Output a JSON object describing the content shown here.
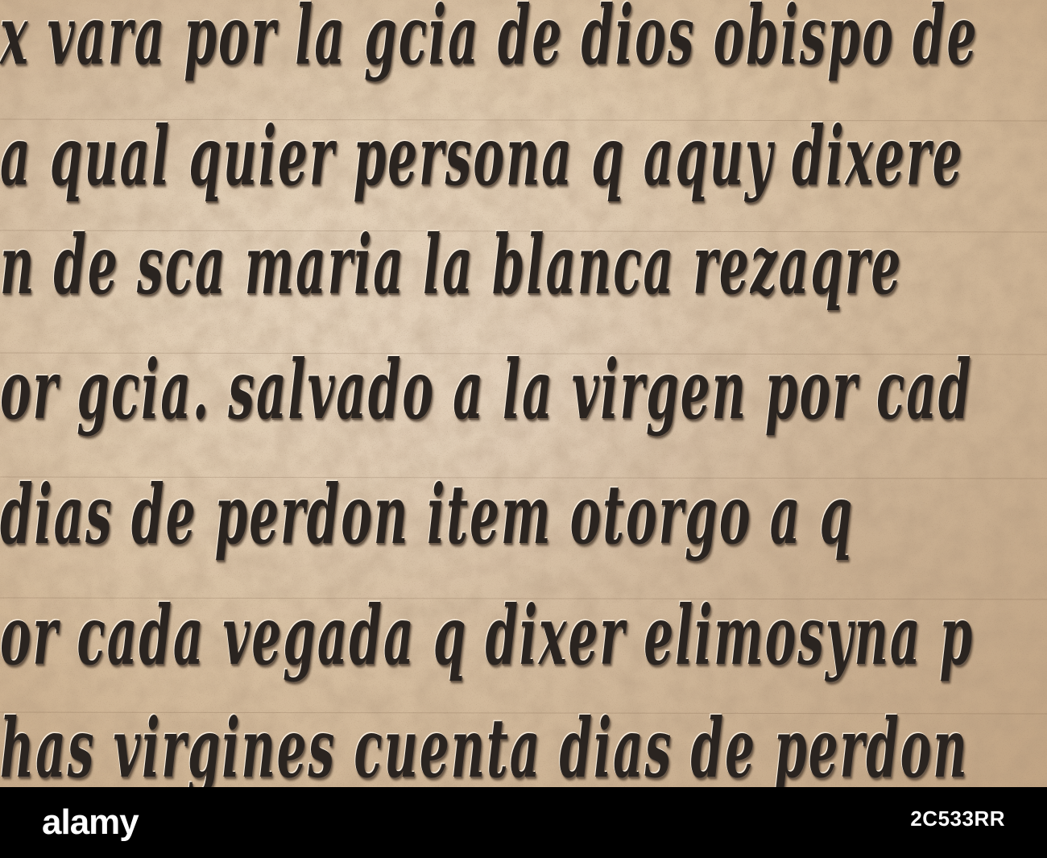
{
  "inscription": {
    "lines": [
      "x vara por la gcia de dios obispo de",
      "a qual quier persona q aquy dixere",
      "n de sca maria la blanca rezaqre",
      "or gcia. salvado a la virgen por cad",
      "dias de perdon item otorgo a q",
      "or cada vegada q dixer elimosyna p",
      "has virgines cuenta dias de perdon"
    ]
  },
  "watermark": {
    "logo_text": "alamy",
    "image_id": "2C533RR"
  },
  "colors": {
    "stone": "#dcc6aa",
    "letter": "#2a2420",
    "footer": "#000000",
    "footer_text": "#ffffff"
  }
}
